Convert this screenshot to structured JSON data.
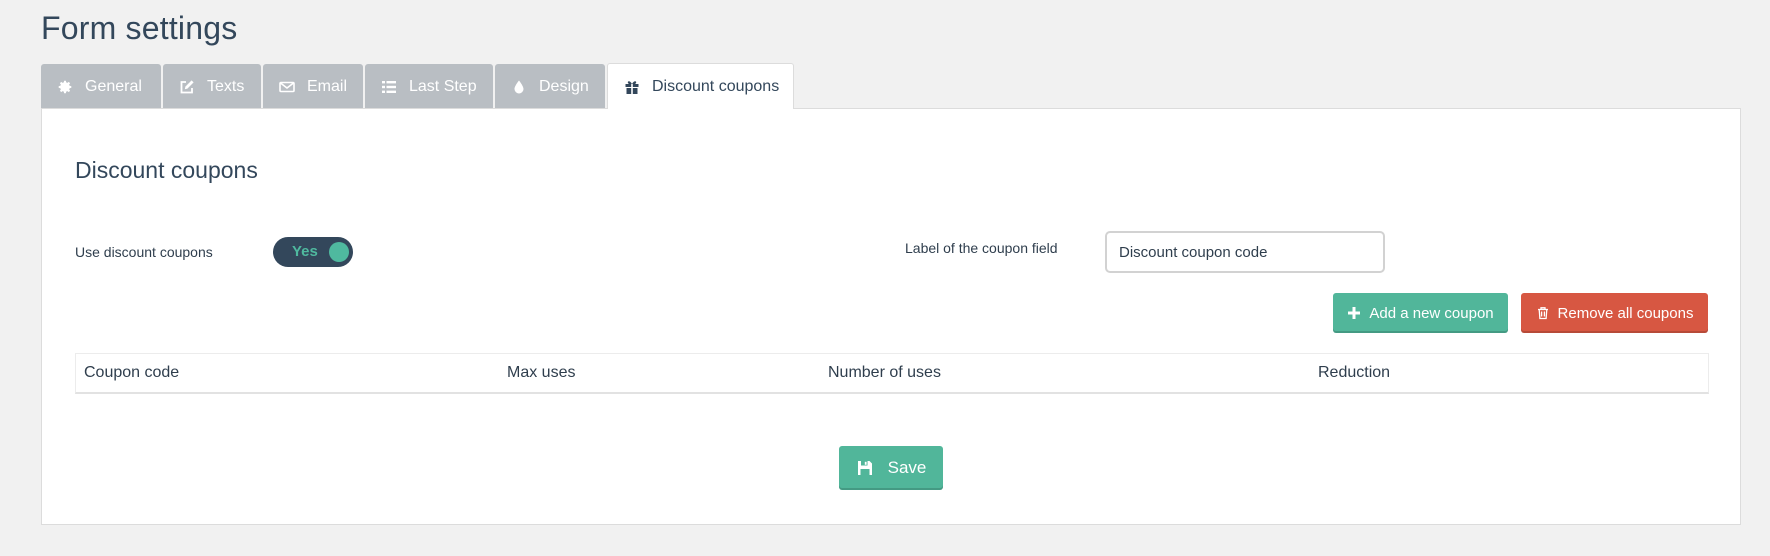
{
  "page": {
    "title": "Form settings"
  },
  "tabs": [
    {
      "label": "General",
      "icon": "gear-icon",
      "active": false
    },
    {
      "label": "Texts",
      "icon": "edit-icon",
      "active": false
    },
    {
      "label": "Email",
      "icon": "envelope-icon",
      "active": false
    },
    {
      "label": "Last Step",
      "icon": "list-icon",
      "active": false
    },
    {
      "label": "Design",
      "icon": "droplet-icon",
      "active": false
    },
    {
      "label": "Discount coupons",
      "icon": "gift-icon",
      "active": true
    }
  ],
  "section": {
    "title": "Discount coupons"
  },
  "use_coupons": {
    "label": "Use discount coupons",
    "toggle_text": "Yes",
    "enabled": true
  },
  "coupon_field": {
    "label": "Label of the coupon field",
    "value": "Discount coupon code"
  },
  "actions": {
    "add_label": "Add a new coupon",
    "add_icon": "plus-icon",
    "remove_label": "Remove all coupons",
    "remove_icon": "trash-icon"
  },
  "table": {
    "columns": [
      "Coupon code",
      "Max uses",
      "Number of uses",
      "Reduction"
    ]
  },
  "save": {
    "label": "Save",
    "icon": "floppy-disk-icon"
  },
  "colors": {
    "accent_green": "#51b69a",
    "danger_red": "#d75742",
    "tab_inactive": "#b9bec3",
    "dark_navy": "#33475b"
  }
}
